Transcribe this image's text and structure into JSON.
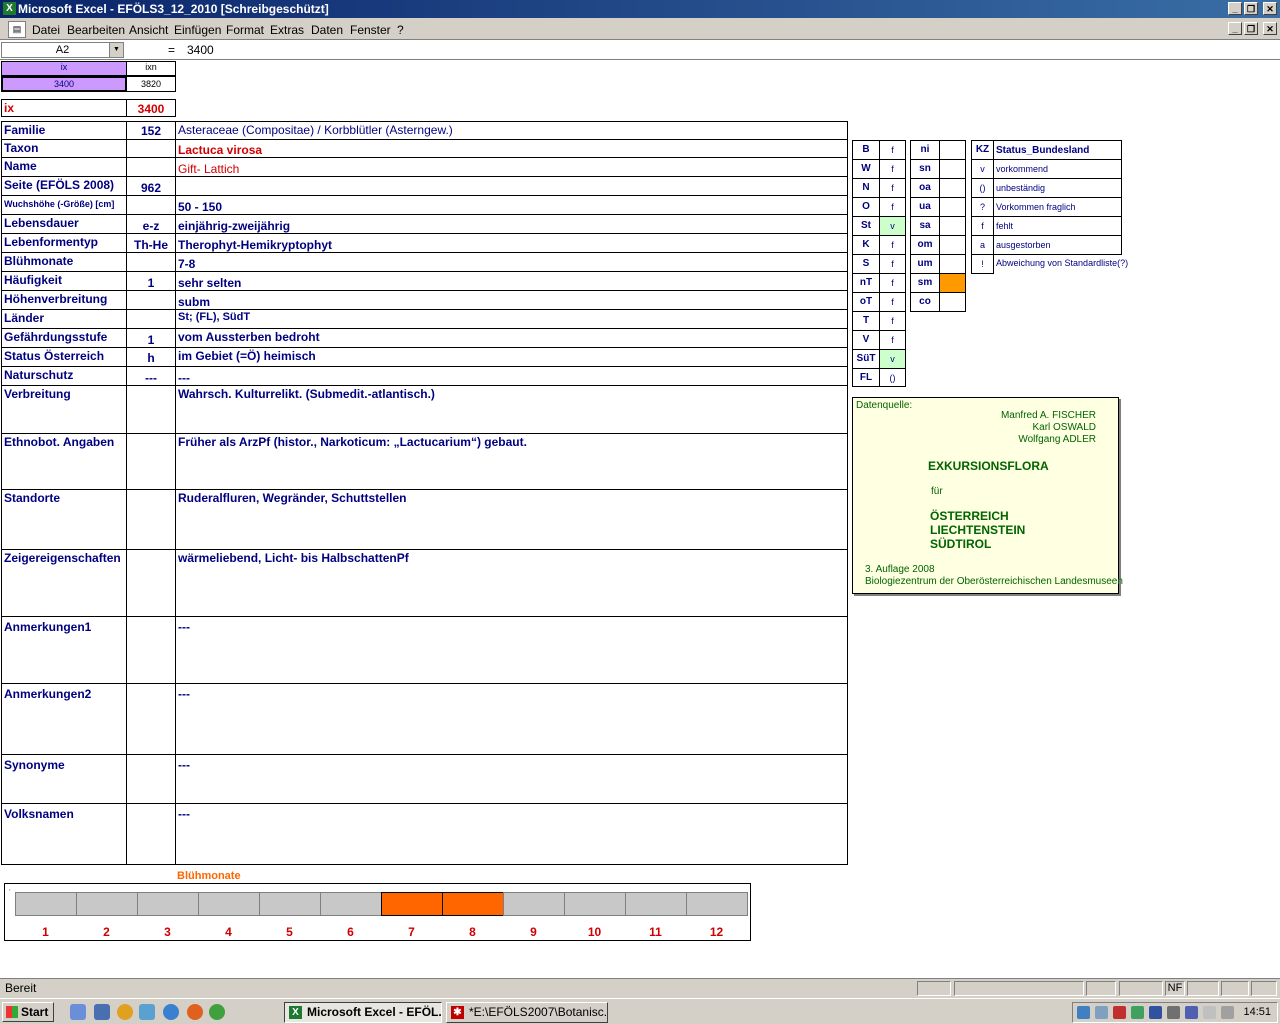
{
  "window": {
    "title": "Microsoft Excel - EFÖLS3_12_2010  [Schreibgeschützt]"
  },
  "menu": [
    "Datei",
    "Bearbeiten",
    "Ansicht",
    "Einfügen",
    "Format",
    "Extras",
    "Daten",
    "Fenster",
    "?"
  ],
  "formula": {
    "cell_ref": "A2",
    "equals": "=",
    "value": "3400"
  },
  "header_cells": {
    "ix_label": "ix",
    "ixn_label": "ixn",
    "ix_value": "3400",
    "ixn_value": "3820"
  },
  "ix_row": {
    "label": "ix",
    "value": "3400"
  },
  "rows": [
    {
      "label": "Familie",
      "code": "152",
      "text": "Asteraceae (Compositae)  /  Korbblütler (Asterngew.)"
    },
    {
      "label": "Taxon",
      "code": "",
      "text": "Lactuca virosa"
    },
    {
      "label": "Name",
      "code": "",
      "text": "Gift- Lattich"
    },
    {
      "label": "Seite (EFÖLS 2008)",
      "code": "962",
      "text": ""
    },
    {
      "label": "Wuchshöhe (-Größe) [cm]",
      "code": "",
      "text": " 50 - 150"
    },
    {
      "label": "Lebensdauer",
      "code": "e-z",
      "text": "einjährig-zweijährig"
    },
    {
      "label": "Lebenformentyp",
      "code": "Th-He",
      "text": "Therophyt-Hemikryptophyt"
    },
    {
      "label": "Blühmonate",
      "code": "",
      "text": " 7-8"
    },
    {
      "label": "Häufigkeit",
      "code": "1",
      "text": "sehr selten"
    },
    {
      "label": "Höhenverbreitung",
      "code": "",
      "text": "subm"
    },
    {
      "label": "Länder",
      "code": "",
      "text": "St; (FL), SüdT"
    },
    {
      "label": "Gefährdungsstufe",
      "code": "1",
      "text": "vom Aussterben bedroht"
    },
    {
      "label": "Status Österreich",
      "code": "h",
      "text": "im Gebiet (=Ö) heimisch"
    },
    {
      "label": "Naturschutz",
      "code": "---",
      "text": "---"
    },
    {
      "label": "Verbreitung",
      "code": "",
      "text": "Wahrsch. Kulturrelikt. (Submedit.-atlantisch.)"
    },
    {
      "label": "Ethnobot. Angaben",
      "code": "",
      "text": "Früher als ArzPf (histor., Narkoticum: „Lactucarium“) gebaut."
    },
    {
      "label": "Standorte",
      "code": "",
      "text": "Ruderalfluren, Wegränder, Schuttstellen"
    },
    {
      "label": "Zeigereigenschaften",
      "code": "",
      "text": "wärmeliebend, Licht- bis HalbschattenPf"
    },
    {
      "label": "Anmerkungen1",
      "code": "",
      "text": "---"
    },
    {
      "label": "Anmerkungen2",
      "code": "",
      "text": "---"
    },
    {
      "label": "Synonyme",
      "code": "",
      "text": "---"
    },
    {
      "label": "Volksnamen",
      "code": "",
      "text": "---"
    }
  ],
  "bundeslaender": [
    {
      "kz": "B",
      "v": "f"
    },
    {
      "kz": "W",
      "v": "f"
    },
    {
      "kz": "N",
      "v": "f"
    },
    {
      "kz": "O",
      "v": "f"
    },
    {
      "kz": "St",
      "v": "v"
    },
    {
      "kz": "K",
      "v": "f"
    },
    {
      "kz": "S",
      "v": "f"
    },
    {
      "kz": "nT",
      "v": "f"
    },
    {
      "kz": "oT",
      "v": "f"
    },
    {
      "kz": "T",
      "v": "f"
    },
    {
      "kz": "V",
      "v": "f"
    },
    {
      "kz": "SüT",
      "v": "v"
    },
    {
      "kz": "FL",
      "v": "()"
    }
  ],
  "hoehenstufen": [
    {
      "kz": "ni",
      "v": ""
    },
    {
      "kz": "sn",
      "v": ""
    },
    {
      "kz": "oa",
      "v": ""
    },
    {
      "kz": "ua",
      "v": ""
    },
    {
      "kz": "sa",
      "v": ""
    },
    {
      "kz": "om",
      "v": ""
    },
    {
      "kz": "um",
      "v": ""
    },
    {
      "kz": "sm",
      "v": ""
    },
    {
      "kz": "co",
      "v": ""
    }
  ],
  "legend": {
    "header_kz": "KZ",
    "header_status": "Status_Bundesland",
    "items": [
      {
        "kz": "v",
        "text": "vorkommend"
      },
      {
        "kz": "()",
        "text": "unbeständig"
      },
      {
        "kz": "?",
        "text": "Vorkommen fraglich"
      },
      {
        "kz": "f",
        "text": "fehlt"
      },
      {
        "kz": "a",
        "text": "ausgestorben"
      },
      {
        "kz": "!",
        "text": "Abweichung von Standardliste(?)"
      }
    ]
  },
  "datasource": {
    "heading": "Datenquelle:",
    "authors": [
      "Manfred A. FISCHER",
      "Karl OSWALD",
      "Wolfgang ADLER"
    ],
    "book": "EXKURSIONSFLORA",
    "fuer": "für",
    "countries": [
      "ÖSTERREICH",
      "LIECHTENSTEIN",
      "SÜDTIROL"
    ],
    "edition": "3. Auflage 2008",
    "publisher": "Biologiezentrum der Oberösterreichischen Landesmuseen"
  },
  "bluehmonate": {
    "label": "Blühmonate",
    "months": [
      "1",
      "2",
      "3",
      "4",
      "5",
      "6",
      "7",
      "8",
      "9",
      "10",
      "11",
      "12"
    ],
    "flowering": [
      7,
      8
    ],
    "on_color": "#ff6600",
    "off_color": "#c8c8c8"
  },
  "statusbar": {
    "text": "Bereit",
    "nf": "NF"
  },
  "taskbar": {
    "start": "Start",
    "tasks": [
      "Microsoft Excel - EFÖL...",
      "*E:\\EFÖLS2007\\Botanisc..."
    ],
    "clock": "14:51"
  }
}
